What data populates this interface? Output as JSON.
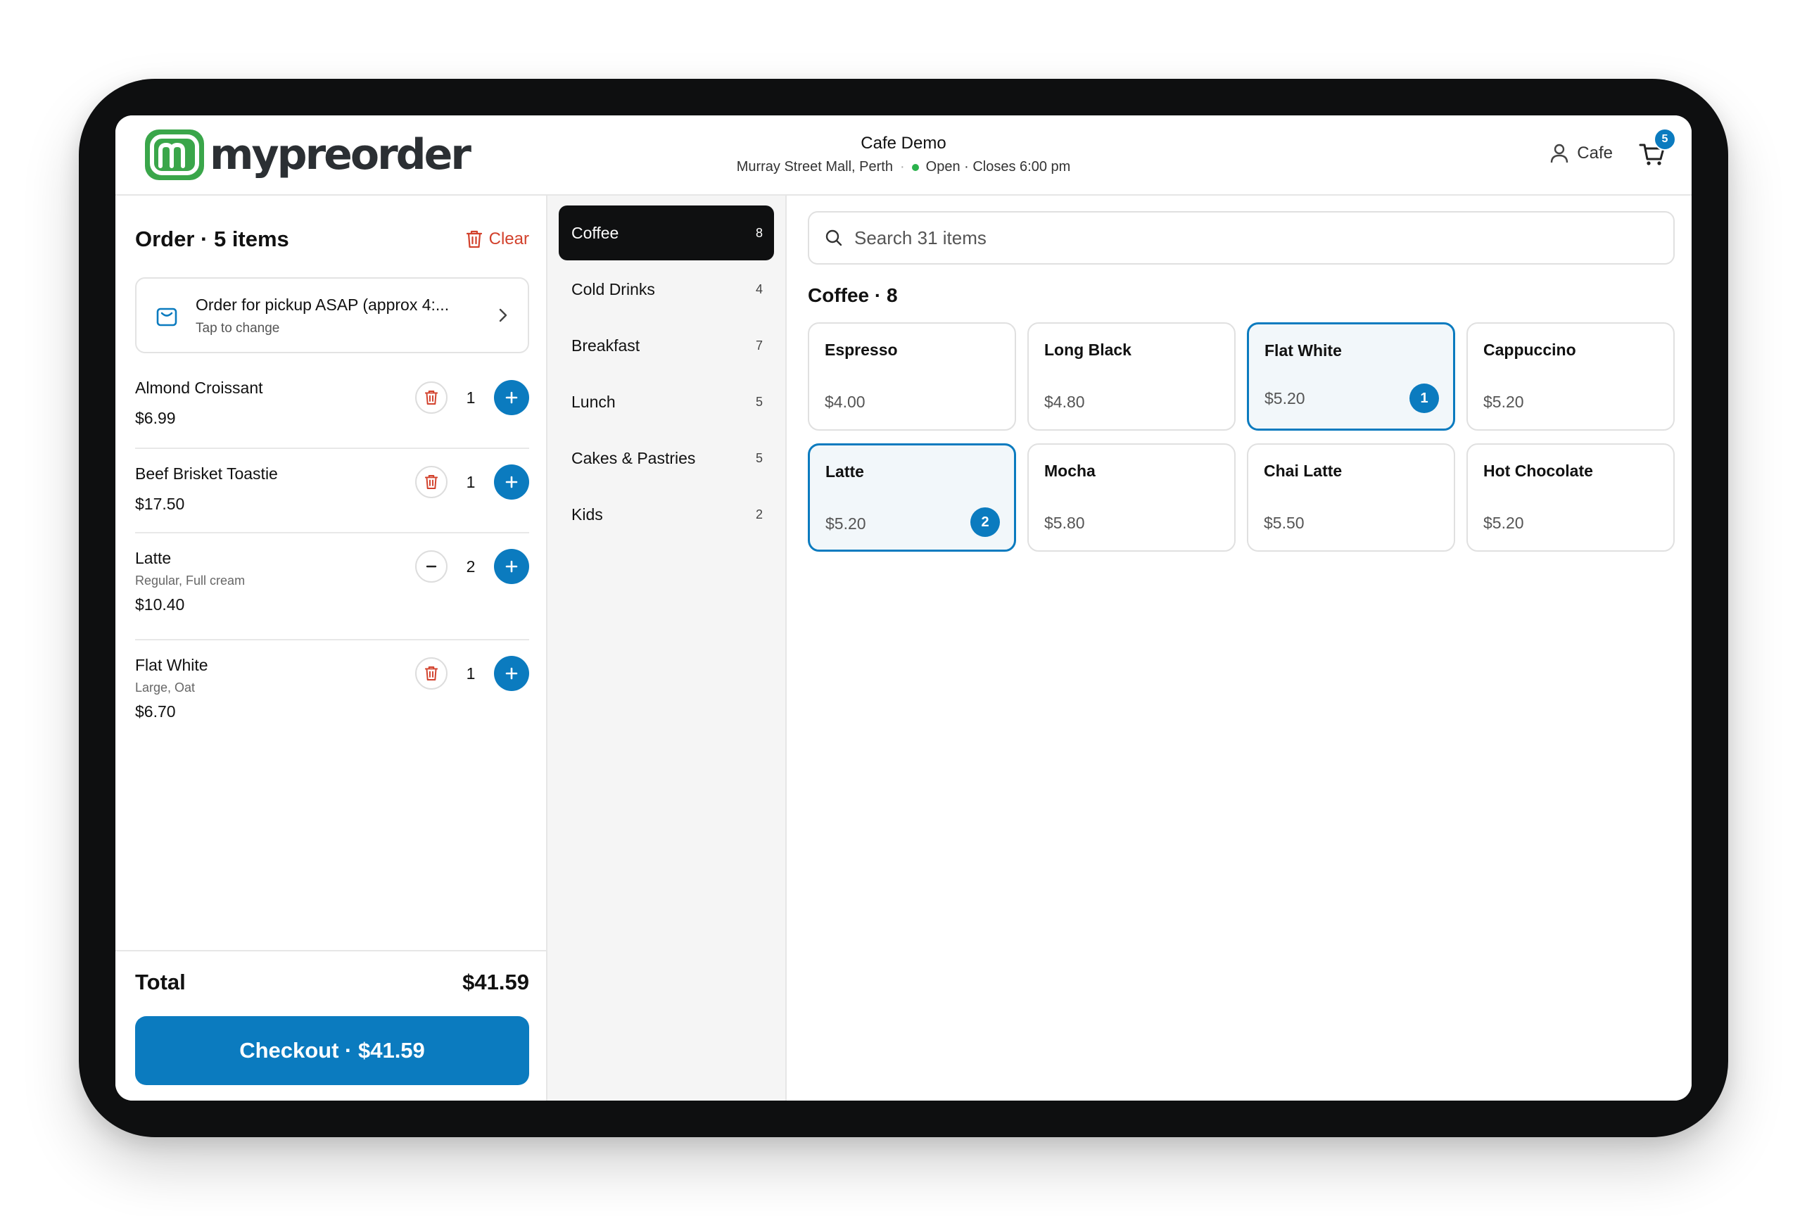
{
  "header": {
    "logo_text": "mypreorder",
    "store_name": "Cafe Demo",
    "store_location": "Murray Street Mall, Perth",
    "store_status": "Open · Closes 6:00 pm",
    "user_label": "Cafe",
    "cart_count": "5"
  },
  "order": {
    "title": "Order · 5 items",
    "clear_label": "Clear",
    "pickup_title": "Order for pickup ASAP (approx 4:...",
    "pickup_sub": "Tap to change",
    "items": [
      {
        "name": "Almond Croissant",
        "options": "",
        "price": "$6.99",
        "qty": "1"
      },
      {
        "name": "Beef Brisket Toastie",
        "options": "",
        "price": "$17.50",
        "qty": "1"
      },
      {
        "name": "Latte",
        "options": "Regular, Full cream",
        "price": "$10.40",
        "qty": "2"
      },
      {
        "name": "Flat White",
        "options": "Large, Oat",
        "price": "$6.70",
        "qty": "1"
      }
    ],
    "total_label": "Total",
    "total_value": "$41.59",
    "checkout_label": "Checkout · $41.59"
  },
  "categories": [
    {
      "label": "Coffee",
      "count": "8",
      "active": true
    },
    {
      "label": "Cold Drinks",
      "count": "4"
    },
    {
      "label": "Breakfast",
      "count": "7"
    },
    {
      "label": "Lunch",
      "count": "5"
    },
    {
      "label": "Cakes & Pastries",
      "count": "5"
    },
    {
      "label": "Kids",
      "count": "2"
    }
  ],
  "menu": {
    "search_placeholder": "Search 31 items",
    "section_title": "Coffee · 8",
    "products": [
      {
        "name": "Espresso",
        "price": "$4.00"
      },
      {
        "name": "Long Black",
        "price": "$4.80"
      },
      {
        "name": "Flat White",
        "price": "$5.20",
        "in_cart": "1"
      },
      {
        "name": "Cappuccino",
        "price": "$5.20"
      },
      {
        "name": "Latte",
        "price": "$5.20",
        "in_cart": "2"
      },
      {
        "name": "Mocha",
        "price": "$5.80"
      },
      {
        "name": "Chai Latte",
        "price": "$5.50"
      },
      {
        "name": "Hot Chocolate",
        "price": "$5.20"
      }
    ]
  },
  "colors": {
    "accent": "#0b7bbf",
    "brand_green": "#3aa64a",
    "danger": "#d2412c",
    "open_status": "#2bb24c"
  }
}
